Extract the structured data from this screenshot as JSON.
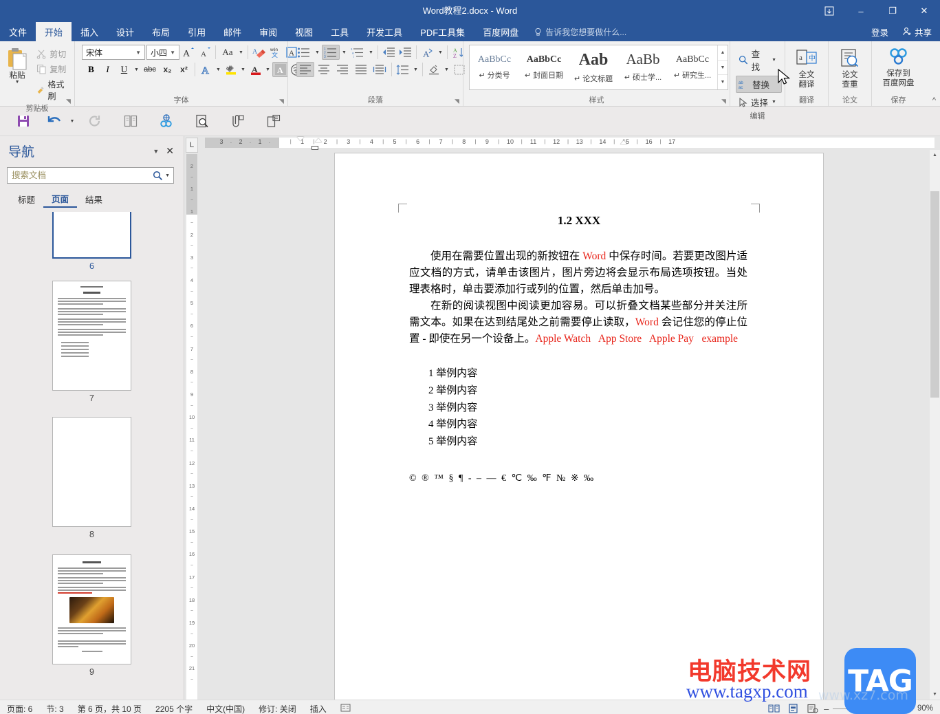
{
  "window": {
    "title": "Word教程2.docx - Word",
    "ribbon_display_icon": "ribbon-display-options-icon",
    "minimize": "–",
    "maximize": "❐",
    "close": "✕"
  },
  "tabs": [
    {
      "label": "文件",
      "active": false
    },
    {
      "label": "开始",
      "active": true
    },
    {
      "label": "插入",
      "active": false
    },
    {
      "label": "设计",
      "active": false
    },
    {
      "label": "布局",
      "active": false
    },
    {
      "label": "引用",
      "active": false
    },
    {
      "label": "邮件",
      "active": false
    },
    {
      "label": "审阅",
      "active": false
    },
    {
      "label": "视图",
      "active": false
    },
    {
      "label": "工具",
      "active": false
    },
    {
      "label": "开发工具",
      "active": false
    },
    {
      "label": "PDF工具集",
      "active": false
    },
    {
      "label": "百度网盘",
      "active": false
    }
  ],
  "tellme": {
    "placeholder": "告诉我您想要做什么...",
    "icon": "lightbulb-icon"
  },
  "account": {
    "signin": "登录",
    "share": "共享",
    "share_icon": "share-person-icon"
  },
  "ribbon": {
    "clipboard": {
      "group_label": "剪贴板",
      "paste_label": "粘贴",
      "cut_label": "剪切",
      "copy_label": "复制",
      "format_painter_label": "格式刷"
    },
    "font": {
      "group_label": "字体",
      "font_family_value": "宋体",
      "font_size_value": "小四",
      "grow_font": "A",
      "shrink_font": "A",
      "change_case": "Aa",
      "clear_formatting": "clear-formatting-icon",
      "phonetic_guide": "wén",
      "character_border": "A",
      "bold": "B",
      "italic": "I",
      "underline": "U",
      "strikethrough": "abc",
      "subscript": "x₂",
      "superscript": "x²",
      "text_effects": "A",
      "highlight": "highlight-icon",
      "font_color": "A",
      "char_shading": "A",
      "enclose_char": "字"
    },
    "paragraph": {
      "group_label": "段落",
      "bullets": "bullet-list-icon",
      "numbering": "numbered-list-icon",
      "multilevel": "multilevel-list-icon",
      "decrease_indent": "decrease-indent-icon",
      "increase_indent": "increase-indent-icon",
      "asian_layout": "asian-layout-icon",
      "sort": "sort-icon",
      "show_marks": "show-paragraph-marks-icon",
      "align_left": "align-left-icon",
      "align_center": "align-center-icon",
      "align_right": "align-right-icon",
      "justify": "justify-icon",
      "distribute": "distribute-icon",
      "line_spacing": "line-spacing-icon",
      "shading": "shading-icon",
      "borders": "borders-icon"
    },
    "styles": {
      "group_label": "样式",
      "items": [
        {
          "preview": "AaBbCc",
          "name": "分类号"
        },
        {
          "preview": "AaBbCc",
          "name": "封面日期"
        },
        {
          "preview": "Aab",
          "name": "论文标题"
        },
        {
          "preview": "AaBb",
          "name": "硕士学..."
        },
        {
          "preview": "AaBbCc",
          "name": "研究生..."
        }
      ],
      "scroll_up": "▲",
      "scroll_down": "▼",
      "more": "▼"
    },
    "editing": {
      "group_label": "编辑",
      "find_label": "查找",
      "replace_label": "替换",
      "select_label": "选择",
      "find_icon": "magnifier-icon",
      "replace_icon": "replace-abac-icon",
      "select_icon": "pointer-icon"
    },
    "translate": {
      "group_label": "翻译",
      "button_line1": "全文",
      "button_line2": "翻译",
      "icon": "translate-icon"
    },
    "thesis": {
      "group_label": "论文",
      "button_line1": "论文",
      "button_line2": "查重",
      "icon": "doc-check-icon"
    },
    "save": {
      "group_label": "保存",
      "button_line1": "保存到",
      "button_line2": "百度网盘",
      "icon": "baidu-netdisk-icon"
    },
    "collapse": "^"
  },
  "quick_toolbar": [
    {
      "name": "save-icon",
      "glyph": "save"
    },
    {
      "name": "undo-icon",
      "glyph": "undo"
    },
    {
      "name": "undo-dropdown-icon",
      "glyph": "caret"
    },
    {
      "name": "redo-icon",
      "glyph": "redo"
    },
    {
      "name": "two-page-icon",
      "glyph": "twopage"
    },
    {
      "name": "hyperlink-icon",
      "glyph": "link"
    },
    {
      "name": "print-preview-icon",
      "glyph": "preview"
    },
    {
      "name": "attachment-icon",
      "glyph": "clip"
    },
    {
      "name": "compare-docs-icon",
      "glyph": "compare"
    }
  ],
  "navigation": {
    "title": "导航",
    "dropdown_icon": "chevron-down-icon",
    "close_icon": "close-icon",
    "search_placeholder": "搜索文档",
    "search_value": "",
    "search_icon": "search-icon",
    "search_dropdown_icon": "caret-down-icon",
    "tabs": [
      {
        "label": "标题",
        "active": false
      },
      {
        "label": "页面",
        "active": true
      },
      {
        "label": "结果",
        "active": false
      }
    ],
    "thumbnails": [
      {
        "page": "6",
        "selected": true,
        "kind": "blank"
      },
      {
        "page": "7",
        "selected": false,
        "kind": "text"
      },
      {
        "page": "8",
        "selected": false,
        "kind": "blank"
      },
      {
        "page": "9",
        "selected": false,
        "kind": "image"
      }
    ]
  },
  "ruler": {
    "corner_icon": "tab-stop-left-icon",
    "h_left_labels": [
      "3",
      "2",
      "1"
    ],
    "h_labels": [
      "1",
      "2",
      "3",
      "4",
      "5",
      "6",
      "7",
      "8",
      "9",
      "10",
      "11",
      "12",
      "13",
      "14",
      "15",
      "16",
      "17"
    ],
    "v_labels": [
      "2",
      "1",
      "1",
      "2",
      "3",
      "4",
      "5",
      "6",
      "7",
      "8",
      "9",
      "10",
      "11",
      "12",
      "13",
      "14",
      "15",
      "16",
      "17",
      "18",
      "19",
      "20",
      "21"
    ]
  },
  "document": {
    "title": "1.2 XXX",
    "paragraphs": [
      {
        "runs": [
          {
            "text": "使用在需要位置出现的新按钮在 ",
            "color": "black"
          },
          {
            "text": "Word",
            "color": "red"
          },
          {
            "text": " 中保存时间。若要更改图片适应文档的方式，请单击该图片，图片旁边将会显示布局选项按钮。当处理表格时，单击要添加行或列的位置，然后单击加号。",
            "color": "black"
          }
        ]
      },
      {
        "runs": [
          {
            "text": "在新的阅读视图中阅读更加容易。可以折叠文档某些部分并关注所需文本。如果在达到结尾处之前需要停止读取，",
            "color": "black"
          },
          {
            "text": "Word",
            "color": "red"
          },
          {
            "text": " 会记住您的停止位置 - 即使在另一个设备上。",
            "color": "black"
          },
          {
            "text": "Apple Watch   App Store   Apple Pay   example",
            "color": "red"
          }
        ]
      }
    ],
    "list": [
      "1 举例内容",
      "2 举例内容",
      "3 举例内容",
      "4 举例内容",
      "5 举例内容"
    ],
    "symbols": "© ® ™ § ¶ - – — € ℃ ‰ ℉ № ※ ‰"
  },
  "status_bar": {
    "page_label": "页面: 6",
    "section_label": "节: 3",
    "page_of": "第 6 页，共 10 页",
    "word_count": "2205 个字",
    "language": "中文(中国)",
    "track_changes": "修订: 关闭",
    "insert_mode": "插入",
    "proofing_icon": "proofing-icon",
    "view_print": "print-layout-view-icon",
    "view_read": "read-mode-icon",
    "view_web": "web-layout-view-icon",
    "zoom_out": "–",
    "zoom_in": "+",
    "zoom_value": "90%"
  },
  "watermark": {
    "site_name": "电脑技术网",
    "site_url": "www.tagxp.com",
    "logo_text": "TAG",
    "faint_text": "www.xz7.com"
  },
  "colors": {
    "brand_blue": "#2b579a",
    "accent_red": "#e8241a",
    "ribbon_bg": "#f1f1f1",
    "workspace_bg": "#e6e6e6",
    "logo_blue": "#3d8bf5"
  }
}
